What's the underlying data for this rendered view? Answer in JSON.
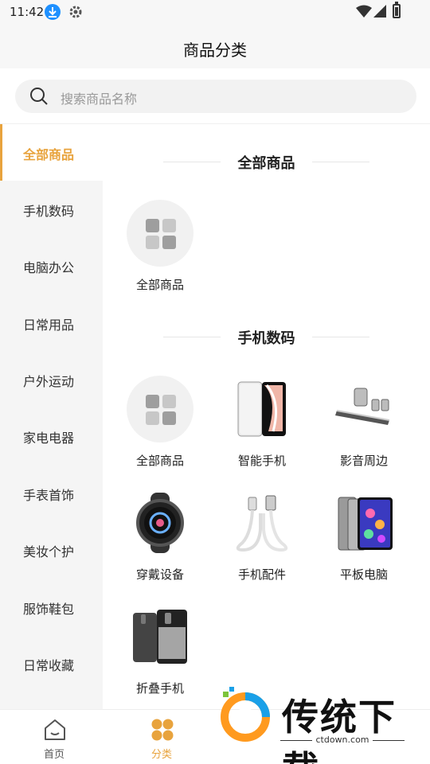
{
  "status_bar": {
    "time": "11:42",
    "icons": [
      "download-icon",
      "gear-icon",
      "wifi-icon",
      "signal-icon",
      "battery-icon"
    ]
  },
  "header": {
    "title": "商品分类"
  },
  "search": {
    "placeholder": "搜索商品名称",
    "icon": "search-icon"
  },
  "sidebar": {
    "active_color": "#e8a33d",
    "items": [
      {
        "label": "全部商品",
        "active": true
      },
      {
        "label": "手机数码"
      },
      {
        "label": "电脑办公"
      },
      {
        "label": "日常用品"
      },
      {
        "label": "户外运动"
      },
      {
        "label": "家电电器"
      },
      {
        "label": "手表首饰"
      },
      {
        "label": "美妆个护"
      },
      {
        "label": "服饰鞋包"
      },
      {
        "label": "日常收藏"
      }
    ]
  },
  "sections": [
    {
      "title": "全部商品",
      "products": [
        {
          "label": "全部商品",
          "icon": "grid-icon"
        }
      ]
    },
    {
      "title": "手机数码",
      "products": [
        {
          "label": "全部商品",
          "icon": "grid-icon"
        },
        {
          "label": "智能手机",
          "icon": "smartphone-image"
        },
        {
          "label": "影音周边",
          "icon": "speaker-image"
        },
        {
          "label": "穿戴设备",
          "icon": "smartwatch-image"
        },
        {
          "label": "手机配件",
          "icon": "usb-cable-image"
        },
        {
          "label": "平板电脑",
          "icon": "tablet-image"
        },
        {
          "label": "折叠手机",
          "icon": "foldable-phone-image"
        }
      ]
    }
  ],
  "bottom_nav": [
    {
      "label": "首页",
      "icon": "home-icon"
    },
    {
      "label": "分类",
      "icon": "category-icon",
      "active": true
    }
  ],
  "watermark": {
    "text": "传统下载",
    "url": "ctdown.com"
  }
}
